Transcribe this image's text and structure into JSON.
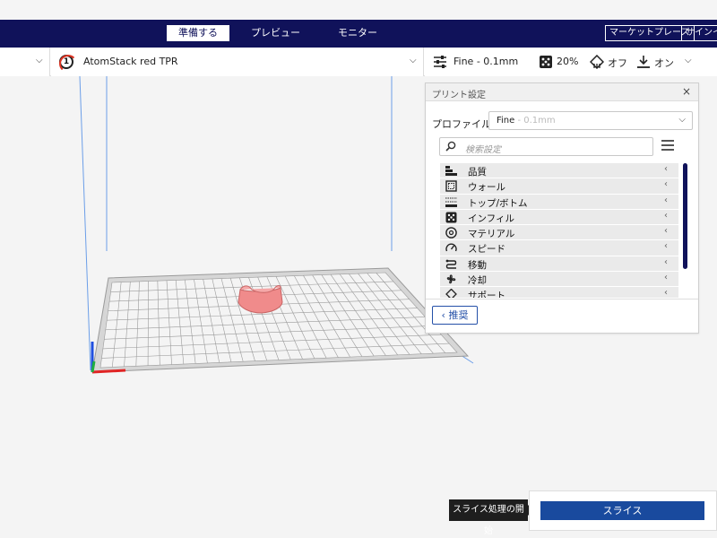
{
  "header": {
    "stages": [
      "準備する",
      "プレビュー",
      "モニター"
    ],
    "active_stage": "準備する",
    "marketplace": "マーケットプレース",
    "signin": "サインイン"
  },
  "toolbar": {
    "printer_number": "1",
    "printer_name": "AtomStack red TPR",
    "profile_summary": "Fine - 0.1mm",
    "infill": "20%",
    "support": "オフ",
    "adhesion": "オン"
  },
  "panel": {
    "title": "プリント設定",
    "profile_label": "プロファイル",
    "profile_value": "Fine",
    "profile_sub": " - 0.1mm",
    "search_placeholder": "検索設定",
    "categories": [
      {
        "label": "品質",
        "icon": "quality-icon"
      },
      {
        "label": "ウォール",
        "icon": "wall-icon"
      },
      {
        "label": "トップ/ボトム",
        "icon": "top-bottom-icon"
      },
      {
        "label": "インフィル",
        "icon": "infill-icon"
      },
      {
        "label": "マテリアル",
        "icon": "material-icon"
      },
      {
        "label": "スピード",
        "icon": "speed-icon"
      },
      {
        "label": "移動",
        "icon": "travel-icon"
      },
      {
        "label": "冷却",
        "icon": "cooling-icon"
      },
      {
        "label": "サポート",
        "icon": "support-icon"
      }
    ],
    "recommended_label": "推奨"
  },
  "slice": {
    "tooltip": "スライス処理の開始",
    "button": "スライス"
  },
  "colors": {
    "header_bg": "#10125a",
    "accent": "#194a9e",
    "model": "#f08b8b"
  }
}
